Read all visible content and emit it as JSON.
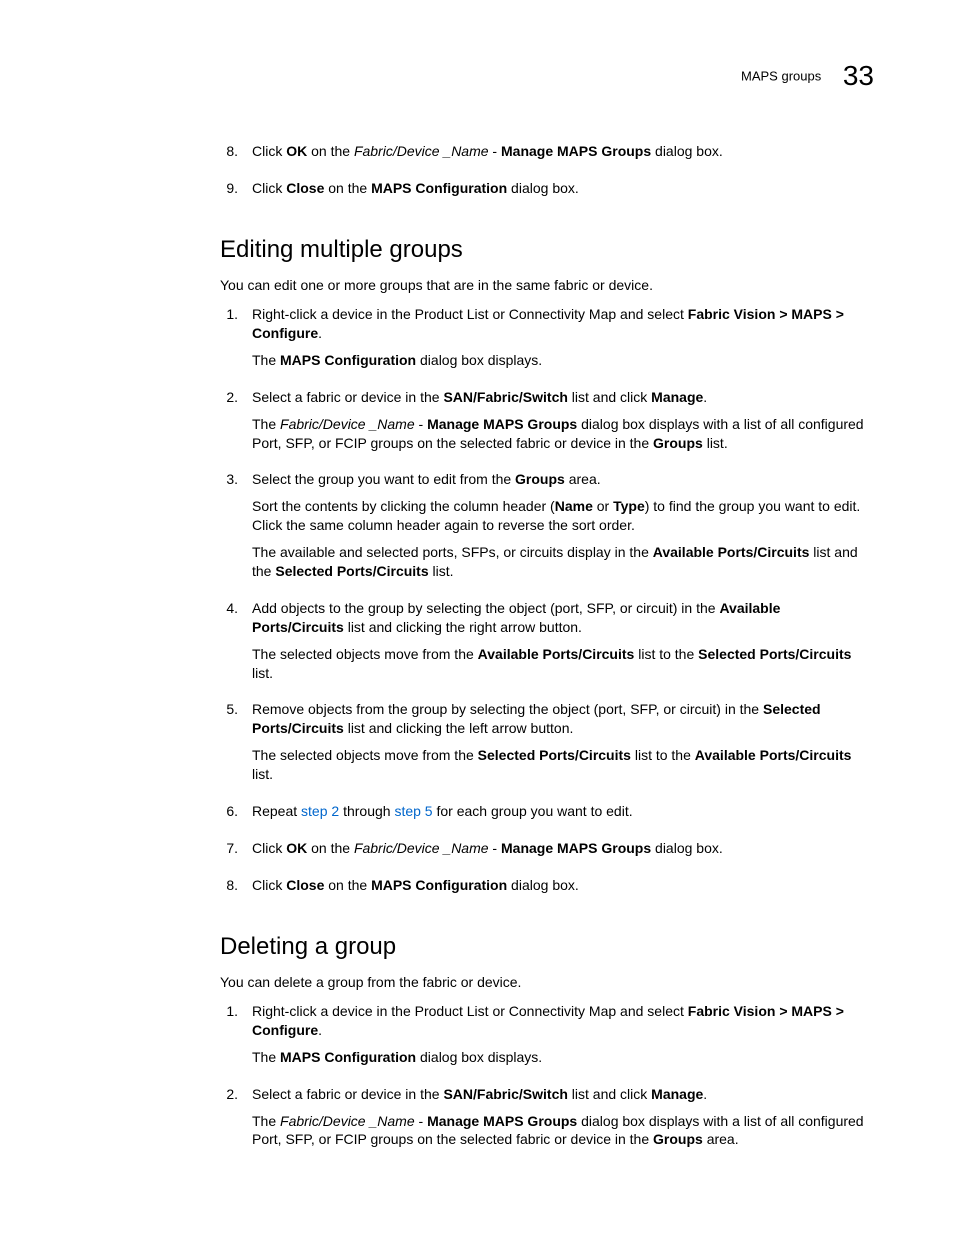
{
  "header": {
    "section_label": "MAPS groups",
    "chapter_number": "33"
  },
  "top_steps": [
    {
      "n": "8.",
      "parts": [
        {
          "t": "Click ",
          "b": false
        },
        {
          "t": "OK",
          "b": true
        },
        {
          "t": " on the ",
          "b": false
        },
        {
          "t": "Fabric/Device _Name",
          "b": false,
          "i": true
        },
        {
          "t": " - ",
          "b": false
        },
        {
          "t": "Manage MAPS Groups",
          "b": true
        },
        {
          "t": " dialog box.",
          "b": false
        }
      ]
    },
    {
      "n": "9.",
      "parts": [
        {
          "t": "Click ",
          "b": false
        },
        {
          "t": "Close",
          "b": true
        },
        {
          "t": " on the ",
          "b": false
        },
        {
          "t": "MAPS Configuration",
          "b": true
        },
        {
          "t": " dialog box.",
          "b": false
        }
      ]
    }
  ],
  "section1": {
    "title": "Editing multiple groups",
    "intro": "You can edit one or more groups that are in the same fabric or device.",
    "steps": [
      {
        "n": "1.",
        "lines": [
          [
            {
              "t": "Right-click a device in the Product List or Connectivity Map and select "
            },
            {
              "t": "Fabric Vision > MAPS > Configure",
              "b": true
            },
            {
              "t": "."
            }
          ],
          [
            {
              "t": "The "
            },
            {
              "t": "MAPS Configuration",
              "b": true
            },
            {
              "t": " dialog box displays."
            }
          ]
        ]
      },
      {
        "n": "2.",
        "lines": [
          [
            {
              "t": "Select a fabric or device in the "
            },
            {
              "t": "SAN/Fabric/Switch",
              "b": true
            },
            {
              "t": " list and click "
            },
            {
              "t": "Manage",
              "b": true
            },
            {
              "t": "."
            }
          ],
          [
            {
              "t": "The "
            },
            {
              "t": "Fabric/Device _Name",
              "i": true
            },
            {
              "t": " - "
            },
            {
              "t": "Manage MAPS Groups",
              "b": true
            },
            {
              "t": " dialog box displays with a list of all configured Port, SFP, or FCIP groups on the selected fabric or device in the "
            },
            {
              "t": "Groups",
              "b": true
            },
            {
              "t": " list."
            }
          ]
        ]
      },
      {
        "n": "3.",
        "lines": [
          [
            {
              "t": "Select the group you want to edit from the "
            },
            {
              "t": "Groups",
              "b": true
            },
            {
              "t": " area."
            }
          ],
          [
            {
              "t": "Sort the contents by clicking the column header ("
            },
            {
              "t": "Name",
              "b": true
            },
            {
              "t": " or "
            },
            {
              "t": "Type",
              "b": true
            },
            {
              "t": ") to find the group you want to edit. Click the same column header again to reverse the sort order."
            }
          ],
          [
            {
              "t": "The available and selected ports, SFPs, or circuits display in the "
            },
            {
              "t": "Available Ports/Circuits",
              "b": true
            },
            {
              "t": " list and the "
            },
            {
              "t": "Selected Ports/Circuits",
              "b": true
            },
            {
              "t": " list."
            }
          ]
        ]
      },
      {
        "n": "4.",
        "lines": [
          [
            {
              "t": "Add objects to the group by selecting the object (port, SFP, or circuit) in the "
            },
            {
              "t": "Available Ports/Circuits",
              "b": true
            },
            {
              "t": " list and clicking the right arrow button."
            }
          ],
          [
            {
              "t": "The selected objects move from the "
            },
            {
              "t": "Available Ports/Circuits",
              "b": true
            },
            {
              "t": " list to the "
            },
            {
              "t": "Selected Ports/Circuits",
              "b": true
            },
            {
              "t": " list."
            }
          ]
        ]
      },
      {
        "n": "5.",
        "lines": [
          [
            {
              "t": "Remove objects from the group by selecting the object (port, SFP, or circuit) in the "
            },
            {
              "t": "Selected Ports/Circuits",
              "b": true
            },
            {
              "t": " list and clicking the left arrow button."
            }
          ],
          [
            {
              "t": "The selected objects move from the "
            },
            {
              "t": "Selected Ports/Circuits",
              "b": true
            },
            {
              "t": " list to the "
            },
            {
              "t": "Available Ports/Circuits",
              "b": true
            },
            {
              "t": " list."
            }
          ]
        ]
      },
      {
        "n": "6.",
        "lines": [
          [
            {
              "t": "Repeat "
            },
            {
              "t": "step 2",
              "link": true
            },
            {
              "t": " through "
            },
            {
              "t": "step 5",
              "link": true
            },
            {
              "t": " for each group you want to edit."
            }
          ]
        ]
      },
      {
        "n": "7.",
        "lines": [
          [
            {
              "t": "Click "
            },
            {
              "t": "OK",
              "b": true
            },
            {
              "t": " on the "
            },
            {
              "t": "Fabric/Device _Name",
              "i": true
            },
            {
              "t": " - "
            },
            {
              "t": "Manage MAPS Groups",
              "b": true
            },
            {
              "t": " dialog box."
            }
          ]
        ]
      },
      {
        "n": "8.",
        "lines": [
          [
            {
              "t": "Click "
            },
            {
              "t": "Close",
              "b": true
            },
            {
              "t": " on the "
            },
            {
              "t": "MAPS Configuration",
              "b": true
            },
            {
              "t": " dialog box."
            }
          ]
        ]
      }
    ]
  },
  "section2": {
    "title": "Deleting a group",
    "intro": "You can delete a group from the fabric or device.",
    "steps": [
      {
        "n": "1.",
        "lines": [
          [
            {
              "t": "Right-click a device in the Product List or Connectivity Map and select "
            },
            {
              "t": "Fabric Vision > MAPS > Configure",
              "b": true
            },
            {
              "t": "."
            }
          ],
          [
            {
              "t": "The "
            },
            {
              "t": "MAPS Configuration",
              "b": true
            },
            {
              "t": " dialog box displays."
            }
          ]
        ]
      },
      {
        "n": "2.",
        "lines": [
          [
            {
              "t": "Select a fabric or device in the "
            },
            {
              "t": "SAN/Fabric/Switch",
              "b": true
            },
            {
              "t": " list and click "
            },
            {
              "t": "Manage",
              "b": true
            },
            {
              "t": "."
            }
          ],
          [
            {
              "t": "The "
            },
            {
              "t": "Fabric/Device _Name",
              "i": true
            },
            {
              "t": " - "
            },
            {
              "t": "Manage MAPS Groups",
              "b": true
            },
            {
              "t": " dialog box displays with a list of all configured Port, SFP, or FCIP groups on the selected fabric or device in the "
            },
            {
              "t": "Groups",
              "b": true
            },
            {
              "t": " area."
            }
          ]
        ]
      }
    ]
  }
}
